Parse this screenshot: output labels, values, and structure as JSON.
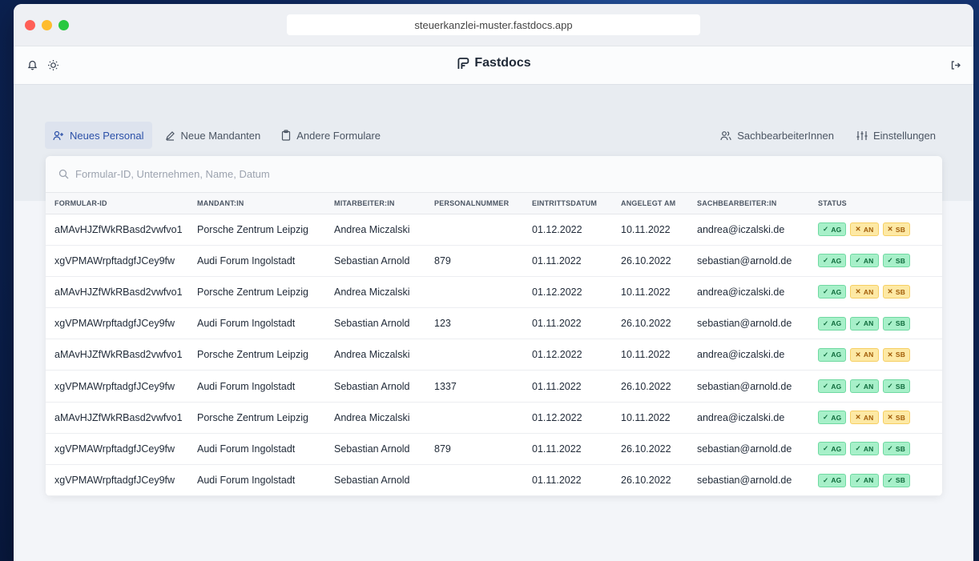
{
  "browser": {
    "url": "steuerkanzlei-muster.fastdocs.app"
  },
  "header": {
    "brand": "Fastdocs",
    "icons": [
      "bell-icon",
      "sun-icon",
      "logout-icon"
    ]
  },
  "tabs": [
    {
      "label": "Neues Personal",
      "icon": "user-plus-icon",
      "active": true
    },
    {
      "label": "Neue Mandanten",
      "icon": "pencil-icon",
      "active": false
    },
    {
      "label": "Andere Formulare",
      "icon": "clipboard-icon",
      "active": false
    }
  ],
  "right_tabs": [
    {
      "label": "SachbearbeiterInnen",
      "icon": "users-icon"
    },
    {
      "label": "Einstellungen",
      "icon": "sliders-icon"
    }
  ],
  "search": {
    "placeholder": "Formular-ID, Unternehmen, Name, Datum",
    "value": ""
  },
  "table": {
    "columns": [
      "FORMULAR-ID",
      "MANDANT:IN",
      "MITARBEITER:IN",
      "PERSONALNUMMER",
      "EINTRITTSDATUM",
      "ANGELEGT AM",
      "SACHBEARBEITER:IN",
      "STATUS"
    ],
    "rows": [
      {
        "id": "aMAvHJZfWkRBasd2vwfvo1",
        "mandant": "Porsche Zentrum Leipzig",
        "mitarbeiter": "Andrea Miczalski",
        "personalnummer": "",
        "eintritt": "01.12.2022",
        "angelegt": "10.11.2022",
        "sachbearbeiter": "andrea@iczalski.de",
        "status": [
          {
            "label": "AG",
            "ok": true
          },
          {
            "label": "AN",
            "ok": false
          },
          {
            "label": "SB",
            "ok": false
          }
        ]
      },
      {
        "id": "xgVPMAWrpftadgfJCey9fw",
        "mandant": "Audi Forum Ingolstadt",
        "mitarbeiter": "Sebastian Arnold",
        "personalnummer": "879",
        "eintritt": "01.11.2022",
        "angelegt": "26.10.2022",
        "sachbearbeiter": "sebastian@arnold.de",
        "status": [
          {
            "label": "AG",
            "ok": true
          },
          {
            "label": "AN",
            "ok": true
          },
          {
            "label": "SB",
            "ok": true
          }
        ]
      },
      {
        "id": "aMAvHJZfWkRBasd2vwfvo1",
        "mandant": "Porsche Zentrum Leipzig",
        "mitarbeiter": "Andrea Miczalski",
        "personalnummer": "",
        "eintritt": "01.12.2022",
        "angelegt": "10.11.2022",
        "sachbearbeiter": "andrea@iczalski.de",
        "status": [
          {
            "label": "AG",
            "ok": true
          },
          {
            "label": "AN",
            "ok": false
          },
          {
            "label": "SB",
            "ok": false
          }
        ]
      },
      {
        "id": "xgVPMAWrpftadgfJCey9fw",
        "mandant": "Audi Forum Ingolstadt",
        "mitarbeiter": "Sebastian Arnold",
        "personalnummer": "123",
        "eintritt": "01.11.2022",
        "angelegt": "26.10.2022",
        "sachbearbeiter": "sebastian@arnold.de",
        "status": [
          {
            "label": "AG",
            "ok": true
          },
          {
            "label": "AN",
            "ok": true
          },
          {
            "label": "SB",
            "ok": true
          }
        ]
      },
      {
        "id": "aMAvHJZfWkRBasd2vwfvo1",
        "mandant": "Porsche Zentrum Leipzig",
        "mitarbeiter": "Andrea Miczalski",
        "personalnummer": "",
        "eintritt": "01.12.2022",
        "angelegt": "10.11.2022",
        "sachbearbeiter": "andrea@iczalski.de",
        "status": [
          {
            "label": "AG",
            "ok": true
          },
          {
            "label": "AN",
            "ok": false
          },
          {
            "label": "SB",
            "ok": false
          }
        ]
      },
      {
        "id": "xgVPMAWrpftadgfJCey9fw",
        "mandant": "Audi Forum Ingolstadt",
        "mitarbeiter": "Sebastian Arnold",
        "personalnummer": "1337",
        "eintritt": "01.11.2022",
        "angelegt": "26.10.2022",
        "sachbearbeiter": "sebastian@arnold.de",
        "status": [
          {
            "label": "AG",
            "ok": true
          },
          {
            "label": "AN",
            "ok": true
          },
          {
            "label": "SB",
            "ok": true
          }
        ]
      },
      {
        "id": "aMAvHJZfWkRBasd2vwfvo1",
        "mandant": "Porsche Zentrum Leipzig",
        "mitarbeiter": "Andrea Miczalski",
        "personalnummer": "",
        "eintritt": "01.12.2022",
        "angelegt": "10.11.2022",
        "sachbearbeiter": "andrea@iczalski.de",
        "status": [
          {
            "label": "AG",
            "ok": true
          },
          {
            "label": "AN",
            "ok": false
          },
          {
            "label": "SB",
            "ok": false
          }
        ]
      },
      {
        "id": "xgVPMAWrpftadgfJCey9fw",
        "mandant": "Audi Forum Ingolstadt",
        "mitarbeiter": "Sebastian Arnold",
        "personalnummer": "879",
        "eintritt": "01.11.2022",
        "angelegt": "26.10.2022",
        "sachbearbeiter": "sebastian@arnold.de",
        "status": [
          {
            "label": "AG",
            "ok": true
          },
          {
            "label": "AN",
            "ok": true
          },
          {
            "label": "SB",
            "ok": true
          }
        ]
      },
      {
        "id": "xgVPMAWrpftadgfJCey9fw",
        "mandant": "Audi Forum Ingolstadt",
        "mitarbeiter": "Sebastian Arnold",
        "personalnummer": "",
        "eintritt": "01.11.2022",
        "angelegt": "26.10.2022",
        "sachbearbeiter": "sebastian@arnold.de",
        "status": [
          {
            "label": "AG",
            "ok": true
          },
          {
            "label": "AN",
            "ok": true
          },
          {
            "label": "SB",
            "ok": true
          }
        ]
      }
    ]
  },
  "colors": {
    "accent": "#2b50a8",
    "ok_bg": "#a7f0c9",
    "warn_bg": "#fde9a5"
  }
}
